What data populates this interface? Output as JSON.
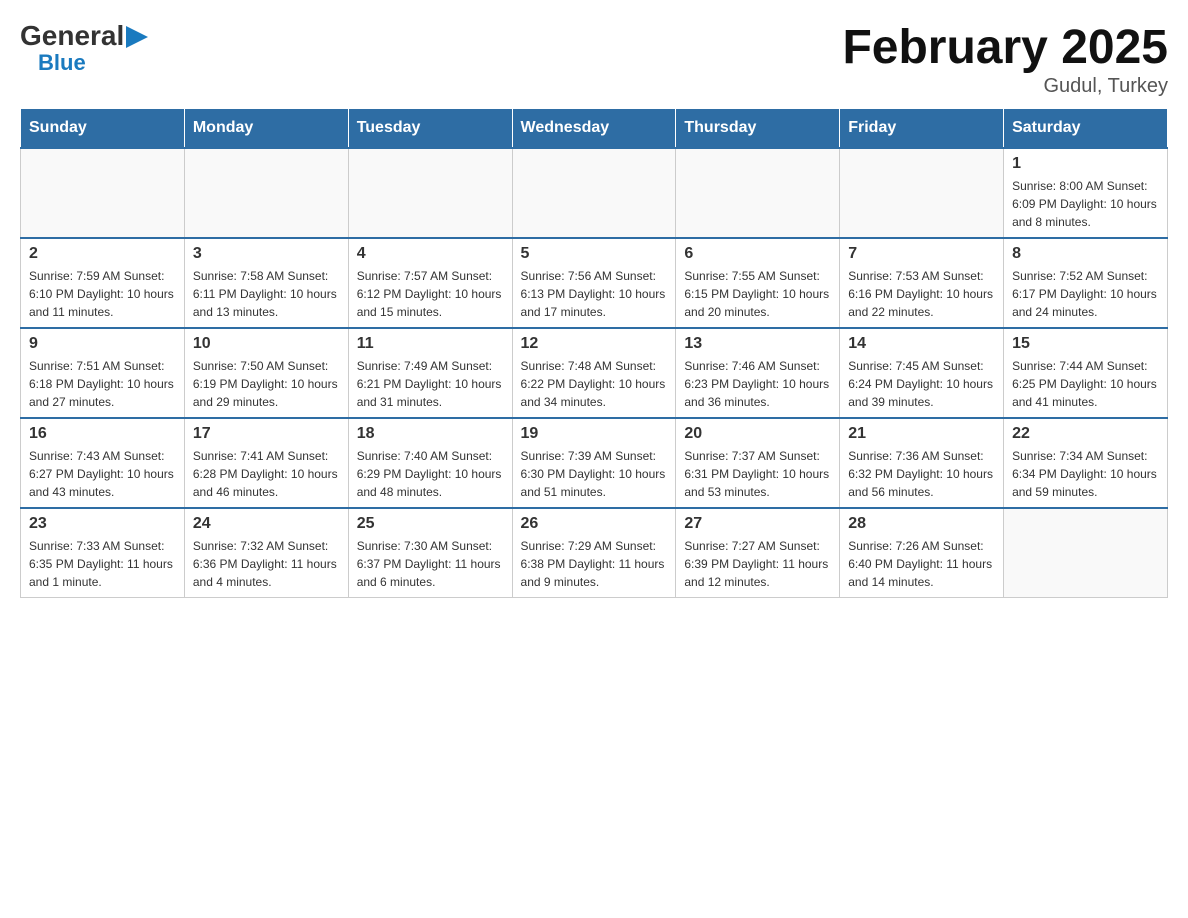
{
  "header": {
    "logo": {
      "general": "General",
      "blue": "Blue"
    },
    "title": "February 2025",
    "location": "Gudul, Turkey"
  },
  "weekdays": [
    "Sunday",
    "Monday",
    "Tuesday",
    "Wednesday",
    "Thursday",
    "Friday",
    "Saturday"
  ],
  "weeks": [
    [
      {
        "day": "",
        "info": ""
      },
      {
        "day": "",
        "info": ""
      },
      {
        "day": "",
        "info": ""
      },
      {
        "day": "",
        "info": ""
      },
      {
        "day": "",
        "info": ""
      },
      {
        "day": "",
        "info": ""
      },
      {
        "day": "1",
        "info": "Sunrise: 8:00 AM\nSunset: 6:09 PM\nDaylight: 10 hours and 8 minutes."
      }
    ],
    [
      {
        "day": "2",
        "info": "Sunrise: 7:59 AM\nSunset: 6:10 PM\nDaylight: 10 hours and 11 minutes."
      },
      {
        "day": "3",
        "info": "Sunrise: 7:58 AM\nSunset: 6:11 PM\nDaylight: 10 hours and 13 minutes."
      },
      {
        "day": "4",
        "info": "Sunrise: 7:57 AM\nSunset: 6:12 PM\nDaylight: 10 hours and 15 minutes."
      },
      {
        "day": "5",
        "info": "Sunrise: 7:56 AM\nSunset: 6:13 PM\nDaylight: 10 hours and 17 minutes."
      },
      {
        "day": "6",
        "info": "Sunrise: 7:55 AM\nSunset: 6:15 PM\nDaylight: 10 hours and 20 minutes."
      },
      {
        "day": "7",
        "info": "Sunrise: 7:53 AM\nSunset: 6:16 PM\nDaylight: 10 hours and 22 minutes."
      },
      {
        "day": "8",
        "info": "Sunrise: 7:52 AM\nSunset: 6:17 PM\nDaylight: 10 hours and 24 minutes."
      }
    ],
    [
      {
        "day": "9",
        "info": "Sunrise: 7:51 AM\nSunset: 6:18 PM\nDaylight: 10 hours and 27 minutes."
      },
      {
        "day": "10",
        "info": "Sunrise: 7:50 AM\nSunset: 6:19 PM\nDaylight: 10 hours and 29 minutes."
      },
      {
        "day": "11",
        "info": "Sunrise: 7:49 AM\nSunset: 6:21 PM\nDaylight: 10 hours and 31 minutes."
      },
      {
        "day": "12",
        "info": "Sunrise: 7:48 AM\nSunset: 6:22 PM\nDaylight: 10 hours and 34 minutes."
      },
      {
        "day": "13",
        "info": "Sunrise: 7:46 AM\nSunset: 6:23 PM\nDaylight: 10 hours and 36 minutes."
      },
      {
        "day": "14",
        "info": "Sunrise: 7:45 AM\nSunset: 6:24 PM\nDaylight: 10 hours and 39 minutes."
      },
      {
        "day": "15",
        "info": "Sunrise: 7:44 AM\nSunset: 6:25 PM\nDaylight: 10 hours and 41 minutes."
      }
    ],
    [
      {
        "day": "16",
        "info": "Sunrise: 7:43 AM\nSunset: 6:27 PM\nDaylight: 10 hours and 43 minutes."
      },
      {
        "day": "17",
        "info": "Sunrise: 7:41 AM\nSunset: 6:28 PM\nDaylight: 10 hours and 46 minutes."
      },
      {
        "day": "18",
        "info": "Sunrise: 7:40 AM\nSunset: 6:29 PM\nDaylight: 10 hours and 48 minutes."
      },
      {
        "day": "19",
        "info": "Sunrise: 7:39 AM\nSunset: 6:30 PM\nDaylight: 10 hours and 51 minutes."
      },
      {
        "day": "20",
        "info": "Sunrise: 7:37 AM\nSunset: 6:31 PM\nDaylight: 10 hours and 53 minutes."
      },
      {
        "day": "21",
        "info": "Sunrise: 7:36 AM\nSunset: 6:32 PM\nDaylight: 10 hours and 56 minutes."
      },
      {
        "day": "22",
        "info": "Sunrise: 7:34 AM\nSunset: 6:34 PM\nDaylight: 10 hours and 59 minutes."
      }
    ],
    [
      {
        "day": "23",
        "info": "Sunrise: 7:33 AM\nSunset: 6:35 PM\nDaylight: 11 hours and 1 minute."
      },
      {
        "day": "24",
        "info": "Sunrise: 7:32 AM\nSunset: 6:36 PM\nDaylight: 11 hours and 4 minutes."
      },
      {
        "day": "25",
        "info": "Sunrise: 7:30 AM\nSunset: 6:37 PM\nDaylight: 11 hours and 6 minutes."
      },
      {
        "day": "26",
        "info": "Sunrise: 7:29 AM\nSunset: 6:38 PM\nDaylight: 11 hours and 9 minutes."
      },
      {
        "day": "27",
        "info": "Sunrise: 7:27 AM\nSunset: 6:39 PM\nDaylight: 11 hours and 12 minutes."
      },
      {
        "day": "28",
        "info": "Sunrise: 7:26 AM\nSunset: 6:40 PM\nDaylight: 11 hours and 14 minutes."
      },
      {
        "day": "",
        "info": ""
      }
    ]
  ]
}
